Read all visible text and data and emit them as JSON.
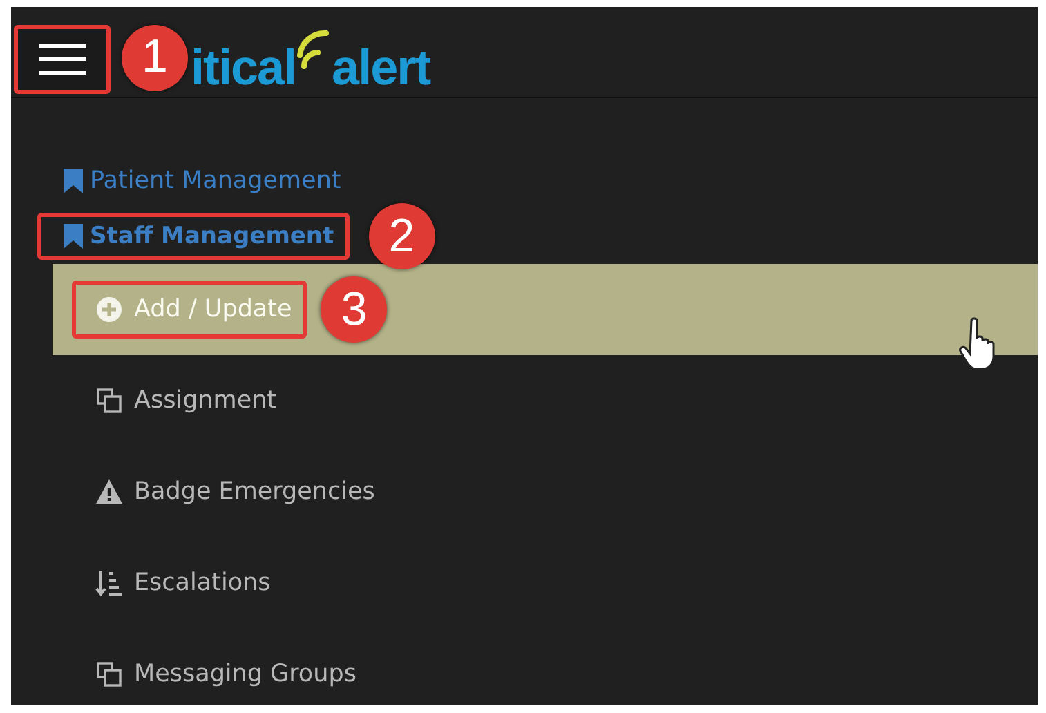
{
  "header": {
    "menu_button": {
      "outlined": true,
      "callout": "1"
    },
    "logo": {
      "part_1": "itical",
      "part_2": "alert"
    }
  },
  "nav": {
    "groups": [
      {
        "label": "Patient Management",
        "expanded": false,
        "outlined": false
      },
      {
        "label": "Staff Management",
        "expanded": true,
        "outlined": true,
        "callout": "2"
      }
    ],
    "items": [
      {
        "label": "Add / Update",
        "kind": "plus-circle",
        "selected": true,
        "outlined": true,
        "callout": "3"
      },
      {
        "label": "Assignment",
        "kind": "copy",
        "selected": false,
        "outlined": false
      },
      {
        "label": "Badge Emergencies",
        "kind": "warning",
        "selected": false,
        "outlined": false
      },
      {
        "label": "Escalations",
        "kind": "sort",
        "selected": false,
        "outlined": false
      },
      {
        "label": "Messaging Groups",
        "kind": "copy",
        "selected": false,
        "outlined": false
      }
    ]
  }
}
